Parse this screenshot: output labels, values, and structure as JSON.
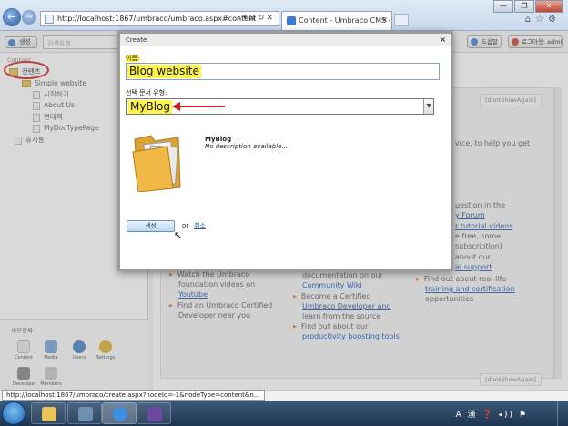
{
  "browser": {
    "address": "http://localhost:1867/umbraco/umbraco.aspx#content",
    "tab_title": "Content - Umbraco CMS -...",
    "tab_close": "×",
    "window_min": "—",
    "window_max": "❐",
    "window_close": "✕"
  },
  "umbraco_toolbar": {
    "create_label": "생성",
    "search_placeholder": "검색유형...",
    "help_label": "도움말",
    "logout_label": "로그아웃: admin"
  },
  "tree": {
    "header": "Content",
    "root": "컨텐츠",
    "nodes": [
      "Simple website",
      "시작하기",
      "About Us",
      "연대책",
      "MyDocTypePage"
    ],
    "recycle": "휴지통"
  },
  "sections": {
    "title": "세부항목",
    "items": [
      "Content",
      "Media",
      "Users",
      "Settings",
      "Developer",
      "Members"
    ]
  },
  "dashboard": {
    "dont_show_again": "[dontShowAgain]",
    "lines": [
      "vice, to help you get",
      "uestion in the",
      "y Forum",
      "r tutorial videos",
      "e free, some",
      " subscription)",
      "about our",
      "al support",
      "Watch the Umbraco",
      "foundation videos on",
      "Youtube",
      "Find an Umbraco Certified",
      "Developer near you",
      "documentation on our",
      "Community Wiki",
      "Become a Certified",
      "Umbraco Developer and",
      "learn from the source",
      "Find out about our",
      "productivity boosting tools",
      "Find out about real-life",
      "training and certification",
      "opportunities"
    ]
  },
  "dialog": {
    "title": "Create",
    "close": "×",
    "name_label": "이름:",
    "name_value": "Blog website",
    "type_label": "선택 문서 유형:",
    "type_value": "MyBlog",
    "doc_title": "MyBlog",
    "doc_desc": "No description available...",
    "ok_label": "생성",
    "or_text": "or",
    "cancel_label": "취소"
  },
  "status": {
    "url": "http://localhost:1867/umbraco/create.aspx?nodeId=-1&nodeType=content&n..."
  },
  "tray": {
    "text": "A 漢 ❓ ◂)) ⚑"
  }
}
